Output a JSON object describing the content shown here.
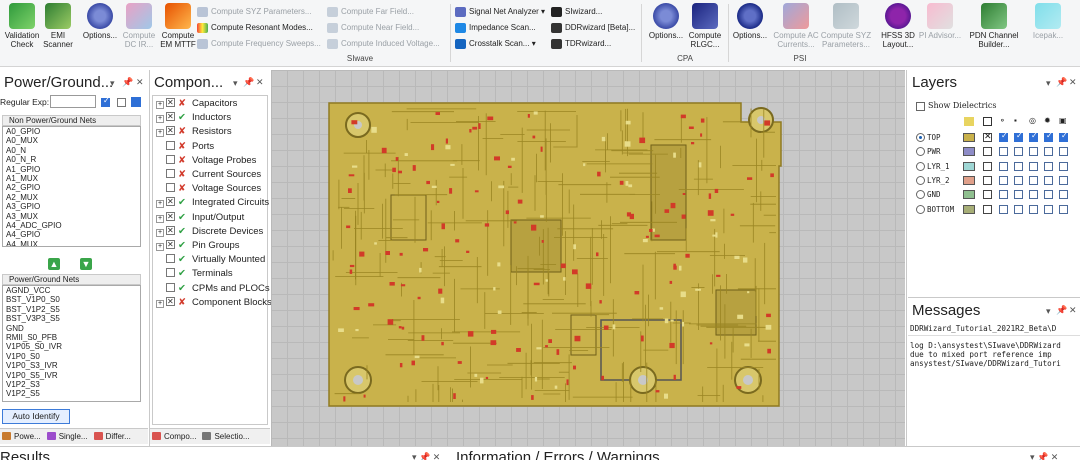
{
  "ribbon": {
    "validation_check": "Validation Check",
    "emi_scanner": "EMI Scanner",
    "options1": "Options...",
    "compute_dc_ir": "Compute DC IR...",
    "compute_em_mttf": "Compute EM MTTF",
    "compute_syz": "Compute SYZ Parameters...",
    "compute_resonant": "Compute Resonant Modes...",
    "compute_freq_sweeps": "Compute Frequency Sweeps...",
    "compute_far_field": "Compute Far Field...",
    "compute_near_field": "Compute Near Field...",
    "compute_induced_voltage": "Compute Induced Voltage...",
    "group_siwave": "SIwave",
    "signal_net_analyzer": "Signal Net Analyzer",
    "impedance_scan": "Impedance Scan...",
    "crosstalk_scan": "Crosstalk Scan...",
    "siwizard": "SIwizard...",
    "ddrwizard": "DDRwizard [Beta]...",
    "tdrwizard": "TDRwizard...",
    "options2": "Options...",
    "compute_rlgc": "Compute RLGC...",
    "group_cpa": "CPA",
    "options3": "Options...",
    "compute_ac_currents": "Compute AC Currents...",
    "compute_syz2": "Compute SYZ Parameters...",
    "hfss_3d_layout": "HFSS 3D Layout...",
    "pi_advisor": "PI Advisor...",
    "group_psi": "PSI",
    "pdn_channel_builder": "PDN Channel Builder...",
    "icepak": "Icepak..."
  },
  "power_panel": {
    "title": "Power/Ground...",
    "regular_exp_label": "Regular Exp:",
    "non_power_header": "Non Power/Ground Nets",
    "non_power_nets": [
      "A0_GPIO",
      "A0_MUX",
      "A0_N",
      "A0_N_R",
      "A1_GPIO",
      "A1_MUX",
      "A2_GPIO",
      "A2_MUX",
      "A3_GPIO",
      "A3_MUX",
      "A4_ADC_GPIO",
      "A4_GPIO",
      "A4_MUX"
    ],
    "power_header": "Power/Ground Nets",
    "power_nets": [
      "AGND_VCC",
      "BST_V1P0_S0",
      "BST_V1P2_S5",
      "BST_V3P3_S5",
      "GND",
      "RMII_S0_PFB",
      "V1P05_S0_IVR",
      "V1P0_S0",
      "V1P0_S3_IVR",
      "V1P0_S5_IVR",
      "V1P2_S3",
      "V1P2_S5"
    ],
    "auto_identify": "Auto Identify",
    "tabs": [
      "Powe...",
      "Single...",
      "Differ..."
    ]
  },
  "component_panel": {
    "title": "Compon...",
    "items": [
      {
        "label": "Capacitors",
        "status": "no",
        "expand": true
      },
      {
        "label": "Inductors",
        "status": "ok",
        "expand": true
      },
      {
        "label": "Resistors",
        "status": "no",
        "expand": true
      },
      {
        "label": "Ports",
        "status": "no",
        "expand": false
      },
      {
        "label": "Voltage Probes",
        "status": "no",
        "expand": false
      },
      {
        "label": "Current Sources",
        "status": "no",
        "expand": false
      },
      {
        "label": "Voltage Sources",
        "status": "no",
        "expand": false
      },
      {
        "label": "Integrated Circuits",
        "status": "ok",
        "expand": true
      },
      {
        "label": "Input/Output",
        "status": "ok",
        "expand": true
      },
      {
        "label": "Discrete Devices",
        "status": "ok",
        "expand": true
      },
      {
        "label": "Pin Groups",
        "status": "ok",
        "expand": true
      },
      {
        "label": "Virtually Mounted",
        "status": "ok",
        "expand": false
      },
      {
        "label": "Terminals",
        "status": "ok",
        "expand": false
      },
      {
        "label": "CPMs and PLOCs",
        "status": "ok",
        "expand": false
      },
      {
        "label": "Component Blocks",
        "status": "no",
        "expand": true
      }
    ],
    "tabs": [
      "Compo...",
      "Selectio..."
    ]
  },
  "layers_panel": {
    "title": "Layers",
    "show_dielectrics": "Show Dielectrics",
    "layers": [
      {
        "name": "TOP",
        "color": "#c9b14a",
        "selected": true
      },
      {
        "name": "PWR",
        "color": "#8e8cc7",
        "selected": false
      },
      {
        "name": "LYR_1",
        "color": "#9fd7d5",
        "selected": false
      },
      {
        "name": "LYR_2",
        "color": "#e0a08a",
        "selected": false
      },
      {
        "name": "GND",
        "color": "#8fbf8f",
        "selected": false
      },
      {
        "name": "BOTTOM",
        "color": "#a7ae77",
        "selected": false
      }
    ]
  },
  "messages_panel": {
    "title": "Messages",
    "lines": [
      "DDRWizard_Tutorial_2021R2_Beta\\D",
      "log D:\\ansystest\\SIwave\\DDRWizard",
      " due to mixed port reference imp",
      "ansystest/SIwave/DDRWizard_Tutori"
    ]
  },
  "bottom": {
    "results_title": "Results",
    "info_title": "Information / Errors / Warnings"
  },
  "colors": {
    "board": "#c9b24b",
    "trace": "#9a8523",
    "pad": "#d23a28",
    "canvas": "#c8c8c8"
  }
}
